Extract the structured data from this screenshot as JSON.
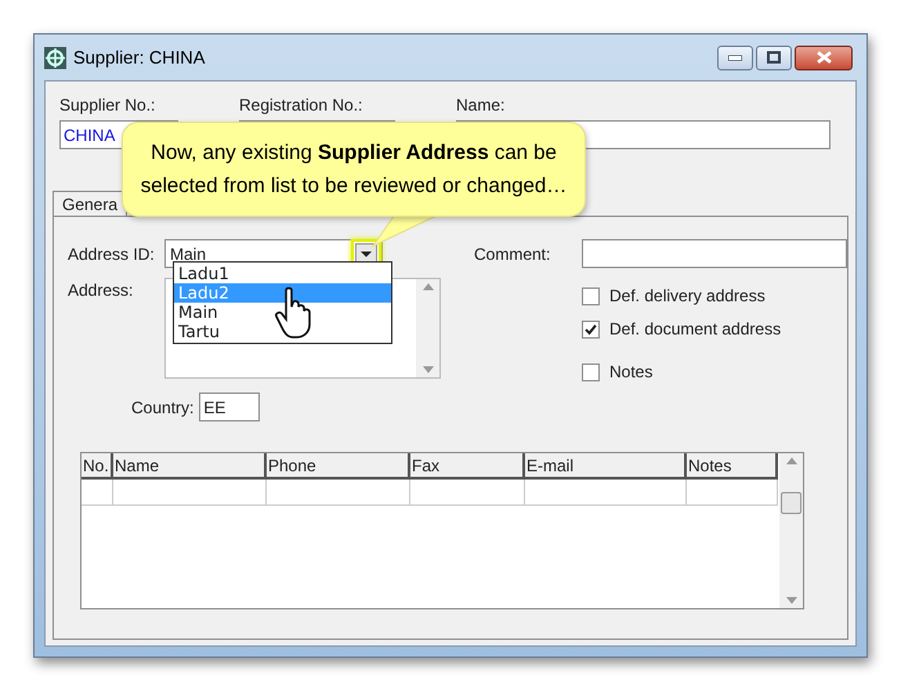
{
  "window": {
    "title": "Supplier: CHINA"
  },
  "fields": [
    {
      "label": "Supplier No.:",
      "value": "CHINA"
    },
    {
      "label": "Registration No.:"
    },
    {
      "label": "Name:"
    }
  ],
  "callout": {
    "text": "Now, any existing **Supplier Address** can be selected from list to be reviewed or changed…"
  },
  "tabs": [
    {
      "label": "Genera",
      "selected": true
    }
  ],
  "address_id": {
    "label": "Address ID:",
    "value": "Main",
    "expanded": true,
    "options": [
      {
        "label": "Ladu1",
        "highlighted": false
      },
      {
        "label": "Ladu2",
        "highlighted": true
      },
      {
        "label": "Main",
        "highlighted": false
      },
      {
        "label": "Tartu",
        "highlighted": false
      }
    ]
  },
  "comment": {
    "label": "Comment:"
  },
  "address": {
    "label": "Address:"
  },
  "checkboxes": [
    {
      "label": "Def. delivery address",
      "checked": false
    },
    {
      "label": "Def. document address",
      "checked": true
    },
    {
      "label": "Notes",
      "checked": false
    }
  ],
  "country": {
    "label": "Country:",
    "value": "EE"
  },
  "table": {
    "columns": [
      "No.",
      "Name",
      "Phone",
      "Fax",
      "E-mail",
      "Notes"
    ]
  }
}
